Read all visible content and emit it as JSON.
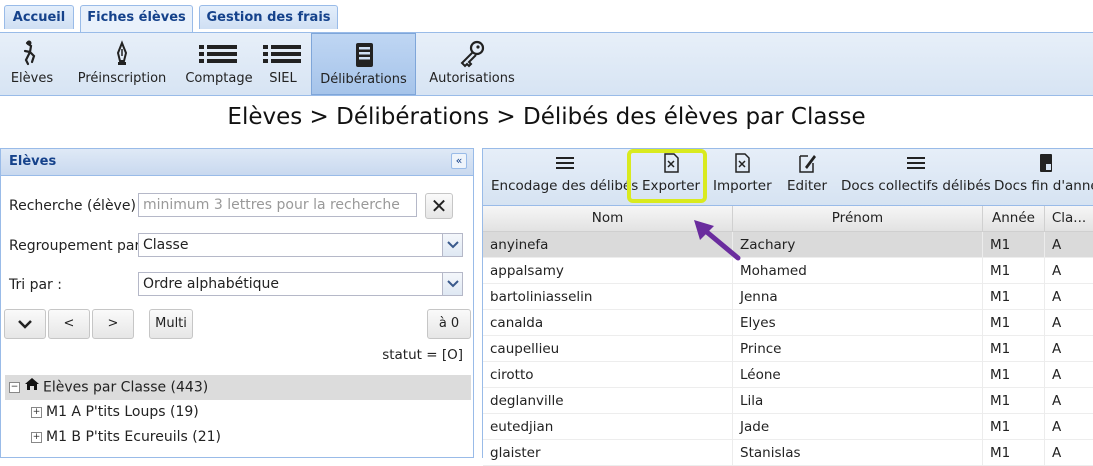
{
  "tabs": [
    "Accueil",
    "Fiches élèves",
    "Gestion des frais"
  ],
  "toolbar": {
    "eleves": "Elèves",
    "preinscription": "Préinscription",
    "comptage": "Comptage",
    "siel": "SIEL",
    "deliberations": "Délibérations",
    "autorisations": "Autorisations"
  },
  "page_title": "Elèves > Délibérations > Délibés des élèves par Classe",
  "left": {
    "title": "Elèves",
    "collapse": "«",
    "search_label": "Recherche (élève) :",
    "search_placeholder": "minimum 3 lettres pour la recherche",
    "group_label": "Regroupement par :",
    "group_value": "Classe",
    "sort_label": "Tri par :",
    "sort_value": "Ordre alphabétique",
    "btn_prev": "<",
    "btn_next": ">",
    "btn_multi": "Multi",
    "btn_zero": "à 0",
    "status": "statut = [O]",
    "tree_root": "Elèves par Classe (443)",
    "tree_items": [
      "M1 A P'tits Loups (19)",
      "M1 B P'tits Ecureuils (21)"
    ]
  },
  "right": {
    "actions": {
      "encodage": "Encodage des délibés",
      "exporter": "Exporter",
      "importer": "Importer",
      "editer": "Editer",
      "docs_collectifs": "Docs collectifs délibés",
      "docs_fin": "Docs fin d'anné"
    },
    "columns": {
      "nom": "Nom",
      "prenom": "Prénom",
      "annee": "Année",
      "classe": "Cla..."
    },
    "rows": [
      {
        "nom": "anyinefa",
        "prenom": "Zachary",
        "annee": "M1",
        "classe": "A"
      },
      {
        "nom": "appalsamy",
        "prenom": "Mohamed",
        "annee": "M1",
        "classe": "A"
      },
      {
        "nom": "bartoliniasselin",
        "prenom": "Jenna",
        "annee": "M1",
        "classe": "A"
      },
      {
        "nom": "canalda",
        "prenom": "Elyes",
        "annee": "M1",
        "classe": "A"
      },
      {
        "nom": "caupellieu",
        "prenom": "Prince",
        "annee": "M1",
        "classe": "A"
      },
      {
        "nom": "cirotto",
        "prenom": "Léone",
        "annee": "M1",
        "classe": "A"
      },
      {
        "nom": "deglanville",
        "prenom": "Lila",
        "annee": "M1",
        "classe": "A"
      },
      {
        "nom": "eutedjian",
        "prenom": "Jade",
        "annee": "M1",
        "classe": "A"
      },
      {
        "nom": "glaister",
        "prenom": "Stanislas",
        "annee": "M1",
        "classe": "A"
      }
    ]
  },
  "colors": {
    "highlight": "#d9ea1f",
    "arrow": "#6a2c9e",
    "accent": "#15428b"
  }
}
